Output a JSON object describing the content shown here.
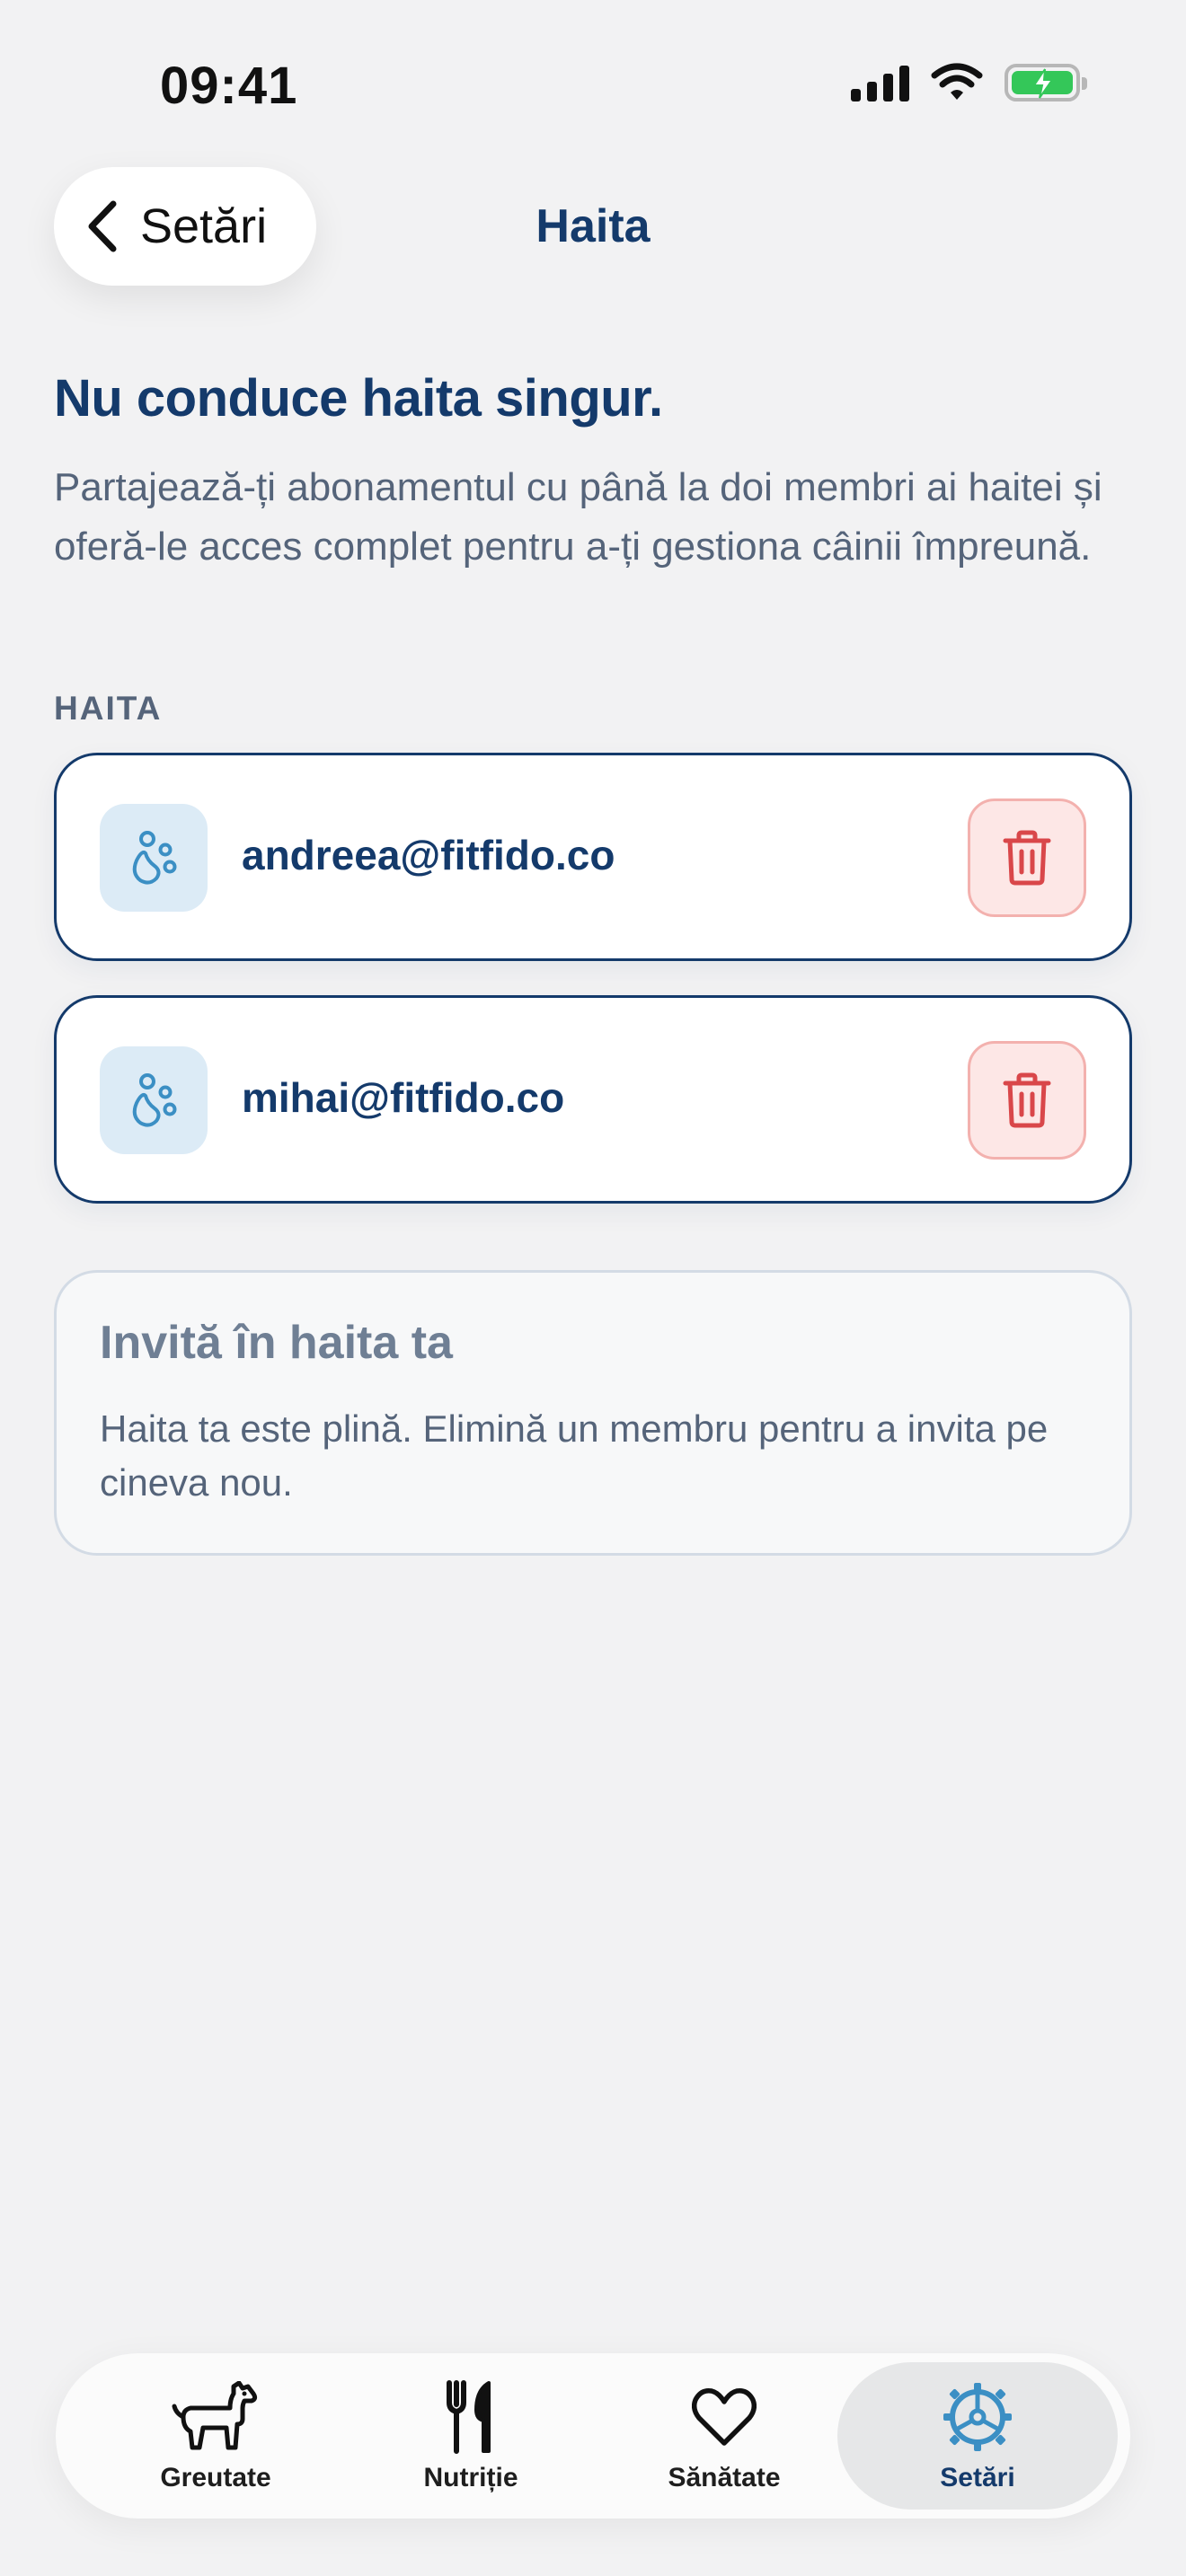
{
  "status_bar": {
    "time": "09:41"
  },
  "nav": {
    "back_label": "Setări",
    "title": "Haita"
  },
  "intro": {
    "headline": "Nu conduce haita singur.",
    "subtitle": "Partajează-ți abonamentul cu până la doi membri ai haitei și oferă-le acces complet pentru a-ți gestiona câinii împreună."
  },
  "pack": {
    "section_label": "HAITA",
    "members": [
      {
        "email": "andreea@fitfido.co",
        "icon": "paw-icon",
        "action_icon": "trash-icon"
      },
      {
        "email": "mihai@fitfido.co",
        "icon": "paw-icon",
        "action_icon": "trash-icon"
      }
    ]
  },
  "invite": {
    "title": "Invită în haita ta",
    "body": "Haita ta este plină. Elimină un membru pentru a invita pe cineva nou."
  },
  "tab_bar": {
    "tabs": [
      {
        "label": "Greutate",
        "icon": "dog-icon"
      },
      {
        "label": "Nutriție",
        "icon": "fork-knife-icon"
      },
      {
        "label": "Sănătate",
        "icon": "heart-icon"
      },
      {
        "label": "Setări",
        "icon": "settings-wheel-icon",
        "active": true
      }
    ]
  },
  "colors": {
    "primary": "#143a6b",
    "paw_accent": "#3b8fc4",
    "danger": "#d9474a",
    "danger_bg": "#fde7e6",
    "battery": "#34c759"
  }
}
